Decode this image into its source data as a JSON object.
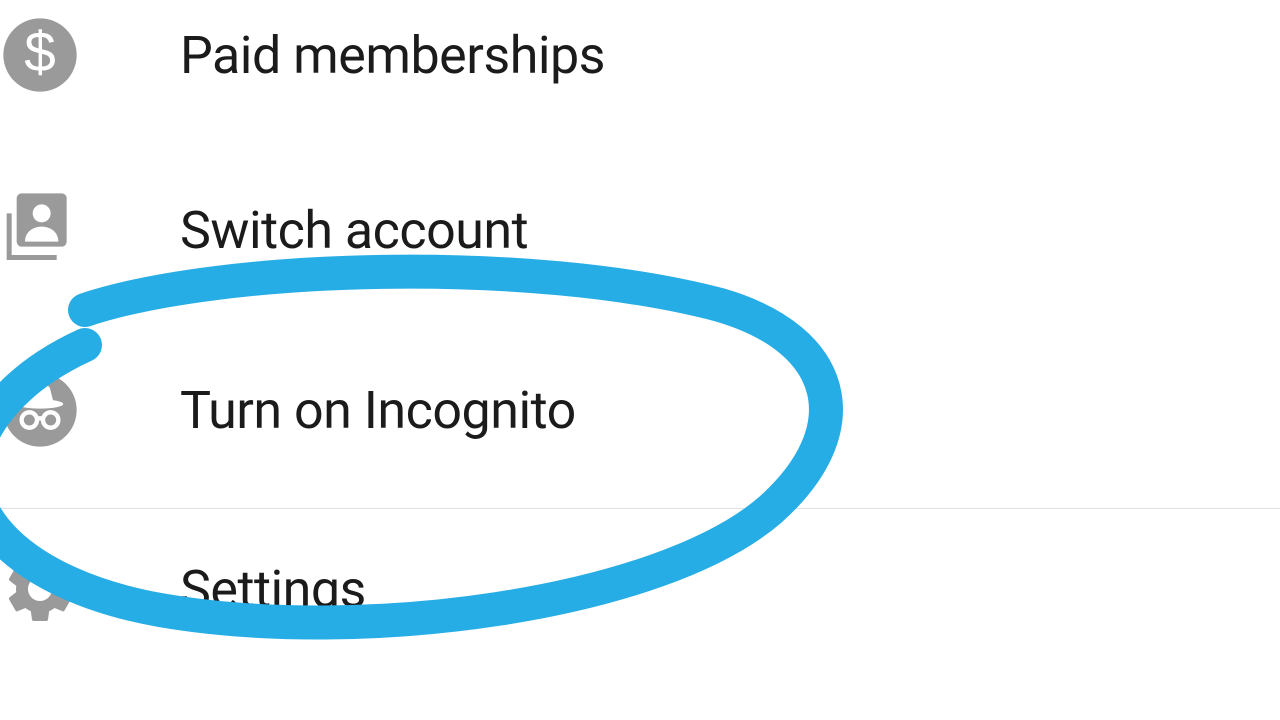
{
  "menu": {
    "paid_label": "Paid memberships",
    "switch_label": "Switch account",
    "incognito_label": "Turn on Incognito",
    "settings_label": "Settings"
  },
  "colors": {
    "icon_gray": "#9a9a9a",
    "text": "#1b1b1b",
    "annotation_blue": "#27ade5"
  }
}
